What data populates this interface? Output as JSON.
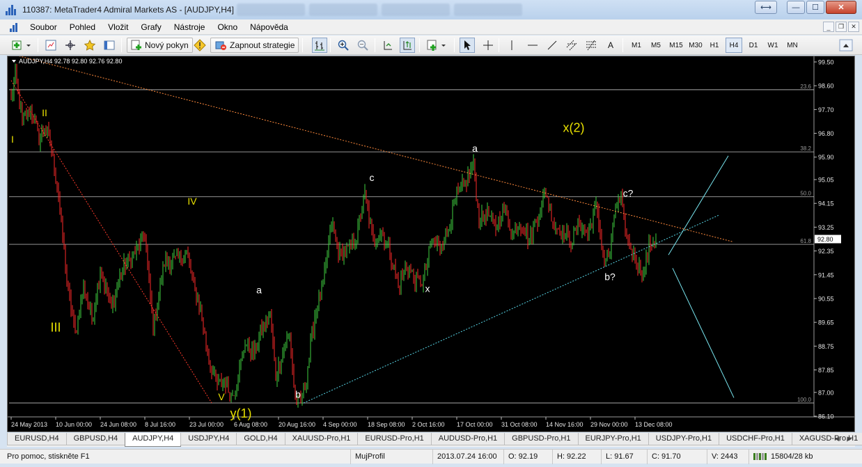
{
  "window": {
    "title": "110387: MetaTrader4 Admiral Markets AS - [AUDJPY,H4]"
  },
  "menu": {
    "items": [
      "Soubor",
      "Pohled",
      "Vložit",
      "Grafy",
      "Nástroje",
      "Okno",
      "Nápověda"
    ]
  },
  "toolbar": {
    "new_order_label": "Nový pokyn",
    "autotrading_label": "Zapnout strategie",
    "line_text_tool": "A",
    "timeframes": [
      "M1",
      "M5",
      "M15",
      "M30",
      "H1",
      "H4",
      "D1",
      "W1",
      "MN"
    ],
    "active_timeframe": "H4"
  },
  "chart": {
    "header_text": "AUDJPY,H4  92.78 92.80 92.76 92.80",
    "current_price_label": "92.80",
    "colors": {
      "background": "#000000",
      "bull": "#3fd13f",
      "bear": "#ff2a2a",
      "wave_labels": "#e8e000",
      "sub_labels": "#ffffff",
      "upper_trendline": "#ff8a3c",
      "lower_trendline": "#58d7e8",
      "projection": "#79e6f0",
      "fib_lines": "#bcbcbc"
    },
    "wave_labels": [
      {
        "text": "I",
        "t": 1,
        "price": 96.45
      },
      {
        "text": "II",
        "t": 24,
        "price": 97.45
      },
      {
        "text": "III",
        "t": 32,
        "price": 89.3
      },
      {
        "text": "IV",
        "t": 130,
        "price": 94.1
      },
      {
        "text": "V",
        "t": 151,
        "price": 86.7
      },
      {
        "text": "y(1)",
        "t": 165,
        "price": 86.05
      },
      {
        "text": "x(2)",
        "t": 404,
        "price": 96.85
      }
    ],
    "sub_labels": [
      {
        "text": "a",
        "t": 178,
        "price": 90.75
      },
      {
        "text": "b",
        "t": 206,
        "price": 86.8
      },
      {
        "text": "c",
        "t": 259,
        "price": 95.0
      },
      {
        "text": "x",
        "t": 299,
        "price": 90.8
      },
      {
        "text": "a",
        "t": 333,
        "price": 96.1
      },
      {
        "text": "c?",
        "t": 443,
        "price": 94.4
      },
      {
        "text": "b?",
        "t": 430,
        "price": 91.25
      }
    ]
  },
  "chart_data": {
    "type": "candlestick",
    "symbol": "AUDJPY",
    "timeframe": "H4",
    "ylim": [
      86.1,
      99.5
    ],
    "price_scale_labels": [
      "99.50",
      "98.60",
      "97.70",
      "96.80",
      "95.90",
      "95.05",
      "94.15",
      "93.25",
      "92.35",
      "91.45",
      "90.55",
      "89.65",
      "88.75",
      "87.85",
      "87.00",
      "86.10"
    ],
    "price_scale_values": [
      99.5,
      98.6,
      97.7,
      96.8,
      95.9,
      95.05,
      94.15,
      93.25,
      92.35,
      91.45,
      90.55,
      89.65,
      88.75,
      87.85,
      87.0,
      86.1
    ],
    "time_labels": [
      "24 May 2013",
      "10 Jun 00:00",
      "24 Jun 08:00",
      "8 Jul 16:00",
      "23 Jul 00:00",
      "6 Aug 08:00",
      "20 Aug 16:00",
      "4 Sep 00:00",
      "18 Sep 08:00",
      "2 Oct 16:00",
      "17 Oct 00:00",
      "31 Oct 08:00",
      "14 Nov 16:00",
      "29 Nov 00:00",
      "13 Dec 08:00"
    ],
    "time_label_bar_index": [
      0,
      32,
      64,
      96,
      128,
      160,
      192,
      224,
      256,
      288,
      320,
      352,
      384,
      416,
      448
    ],
    "fibonacci_levels": [
      {
        "label": "23.6",
        "price": 98.45
      },
      {
        "label": "38.2",
        "price": 96.1
      },
      {
        "label": "50.0",
        "price": 94.4
      },
      {
        "label": "61.8",
        "price": 92.6
      },
      {
        "label": "100.0",
        "price": 86.6
      }
    ],
    "price_path": [
      [
        0,
        98.1
      ],
      [
        3,
        98.95
      ],
      [
        8,
        97.2
      ],
      [
        14,
        97.7
      ],
      [
        20,
        96.6
      ],
      [
        24,
        97.1
      ],
      [
        28,
        96.4
      ],
      [
        34,
        94.5
      ],
      [
        40,
        91.2
      ],
      [
        46,
        89.2
      ],
      [
        52,
        91.0
      ],
      [
        58,
        89.8
      ],
      [
        64,
        91.6
      ],
      [
        72,
        90.2
      ],
      [
        80,
        91.7
      ],
      [
        88,
        92.2
      ],
      [
        96,
        92.9
      ],
      [
        102,
        89.4
      ],
      [
        110,
        91.9
      ],
      [
        118,
        92.0
      ],
      [
        126,
        92.3
      ],
      [
        132,
        90.8
      ],
      [
        136,
        90.2
      ],
      [
        142,
        88.2
      ],
      [
        148,
        87.3
      ],
      [
        154,
        87.4
      ],
      [
        158,
        86.8
      ],
      [
        162,
        87.4
      ],
      [
        168,
        88.9
      ],
      [
        174,
        88.4
      ],
      [
        180,
        89.4
      ],
      [
        186,
        89.9
      ],
      [
        190,
        87.6
      ],
      [
        196,
        88.7
      ],
      [
        200,
        89.2
      ],
      [
        204,
        86.7
      ],
      [
        208,
        86.6
      ],
      [
        212,
        87.6
      ],
      [
        218,
        89.9
      ],
      [
        224,
        91.0
      ],
      [
        230,
        93.4
      ],
      [
        236,
        92.2
      ],
      [
        242,
        92.4
      ],
      [
        248,
        92.9
      ],
      [
        254,
        94.5
      ],
      [
        260,
        92.7
      ],
      [
        266,
        93.1
      ],
      [
        272,
        92.3
      ],
      [
        278,
        91.0
      ],
      [
        284,
        91.8
      ],
      [
        290,
        91.3
      ],
      [
        296,
        91.2
      ],
      [
        302,
        92.7
      ],
      [
        308,
        92.5
      ],
      [
        314,
        93.2
      ],
      [
        320,
        94.4
      ],
      [
        326,
        94.9
      ],
      [
        332,
        95.6
      ],
      [
        336,
        93.5
      ],
      [
        342,
        93.8
      ],
      [
        348,
        93.2
      ],
      [
        354,
        94.0
      ],
      [
        360,
        93.0
      ],
      [
        366,
        93.4
      ],
      [
        372,
        92.8
      ],
      [
        378,
        93.6
      ],
      [
        384,
        94.6
      ],
      [
        390,
        93.3
      ],
      [
        396,
        93.1
      ],
      [
        402,
        92.7
      ],
      [
        408,
        93.4
      ],
      [
        414,
        93.0
      ],
      [
        420,
        94.0
      ],
      [
        426,
        92.0
      ],
      [
        430,
        92.2
      ],
      [
        434,
        94.1
      ],
      [
        438,
        94.2
      ],
      [
        442,
        92.8
      ],
      [
        446,
        92.3
      ],
      [
        450,
        91.8
      ],
      [
        454,
        91.4
      ],
      [
        458,
        92.5
      ],
      [
        462,
        92.8
      ]
    ],
    "total_bars": 464,
    "trendlines": [
      {
        "name": "upper-trendline",
        "style": "dotted",
        "from": [
          0,
          99.8
        ],
        "to": [
          518,
          92.7
        ]
      },
      {
        "name": "lower-trendline",
        "style": "dotted",
        "from": [
          210,
          86.6
        ],
        "to": [
          508,
          93.7
        ]
      },
      {
        "name": "left-decline-line",
        "style": "dotted",
        "from": [
          0,
          98.8
        ],
        "to": [
          144,
          86.6
        ]
      }
    ],
    "projection": [
      {
        "name": "projection-up",
        "from": [
          472,
          92.2
        ],
        "to": [
          515,
          95.95
        ]
      },
      {
        "name": "projection-down",
        "from": [
          475,
          91.7
        ],
        "to": [
          519,
          86.8
        ]
      }
    ],
    "ohlc_header": {
      "open": 92.78,
      "high": 92.8,
      "low": 92.76,
      "close": 92.8
    },
    "current_price": 92.8
  },
  "tabs": {
    "items": [
      "EURUSD,H4",
      "GBPUSD,H4",
      "AUDJPY,H4",
      "USDJPY,H4",
      "GOLD,H4",
      "XAUUSD-Pro,H1",
      "EURUSD-Pro,H1",
      "AUDUSD-Pro,H1",
      "GBPUSD-Pro,H1",
      "EURJPY-Pro,H1",
      "USDJPY-Pro,H1",
      "USDCHF-Pro,H1",
      "XAGUSD-Pro,H1"
    ],
    "active": "AUDJPY,H4"
  },
  "status": {
    "help": "Pro pomoc, stiskněte F1",
    "profile": "MujProfil",
    "datetime": "2013.07.24 16:00",
    "open": "O: 92.19",
    "high": "H: 92.22",
    "low": "L: 91.67",
    "close": "C: 91.70",
    "volume": "V: 2443",
    "traffic": "15804/28 kb"
  }
}
